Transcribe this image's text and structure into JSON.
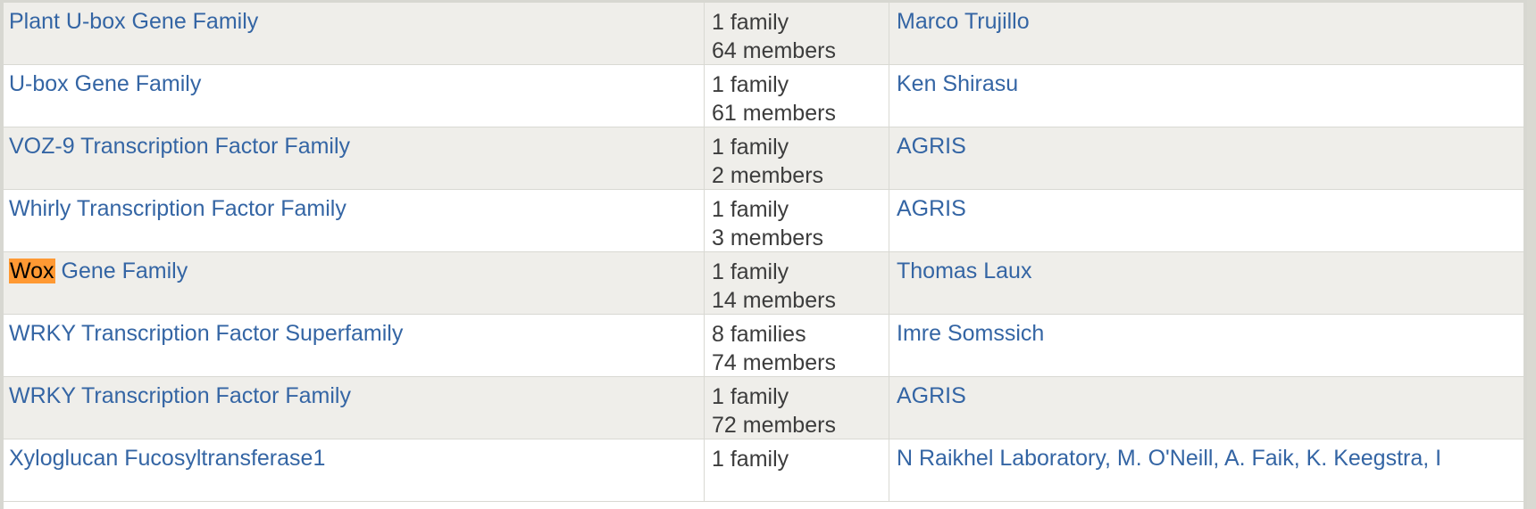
{
  "colors": {
    "link": "#3465a4",
    "text": "#3c3c3c",
    "row_alt_bg": "#efeeea",
    "row_bg": "#ffffff",
    "border": "#d9d9d3",
    "highlight_bg": "#ff9933",
    "highlight_fg": "#000000",
    "page_bg": "#d9d9d2"
  },
  "table": {
    "rows": [
      {
        "name": "Plant U-box Gene Family",
        "name_pre": "",
        "name_highlight": "",
        "name_post": "",
        "families": "1 family",
        "members": "64 members",
        "author": "Marco Trujillo"
      },
      {
        "name": "U-box Gene Family",
        "name_pre": "",
        "name_highlight": "",
        "name_post": "",
        "families": "1 family",
        "members": "61 members",
        "author": "Ken Shirasu"
      },
      {
        "name": "VOZ-9 Transcription Factor Family",
        "name_pre": "",
        "name_highlight": "",
        "name_post": "",
        "families": "1 family",
        "members": "2 members",
        "author": "AGRIS"
      },
      {
        "name": "Whirly Transcription Factor Family",
        "name_pre": "",
        "name_highlight": "",
        "name_post": "",
        "families": "1 family",
        "members": "3 members",
        "author": "AGRIS"
      },
      {
        "name": "Wox Gene Family",
        "name_pre": "",
        "name_highlight": "Wox",
        "name_post": " Gene Family",
        "families": "1 family",
        "members": "14 members",
        "author": "Thomas Laux"
      },
      {
        "name": "WRKY Transcription Factor Superfamily",
        "name_pre": "",
        "name_highlight": "",
        "name_post": "",
        "families": "8 families",
        "members": "74 members",
        "author": "Imre Somssich"
      },
      {
        "name": "WRKY Transcription Factor Family",
        "name_pre": "",
        "name_highlight": "",
        "name_post": "",
        "families": "1 family",
        "members": "72 members",
        "author": "AGRIS"
      },
      {
        "name": "Xyloglucan Fucosyltransferase1",
        "name_pre": "",
        "name_highlight": "",
        "name_post": "",
        "families": "1 family",
        "members": "",
        "author": "N Raikhel Laboratory, M. O'Neill, A. Faik, K. Keegstra, I"
      }
    ]
  }
}
